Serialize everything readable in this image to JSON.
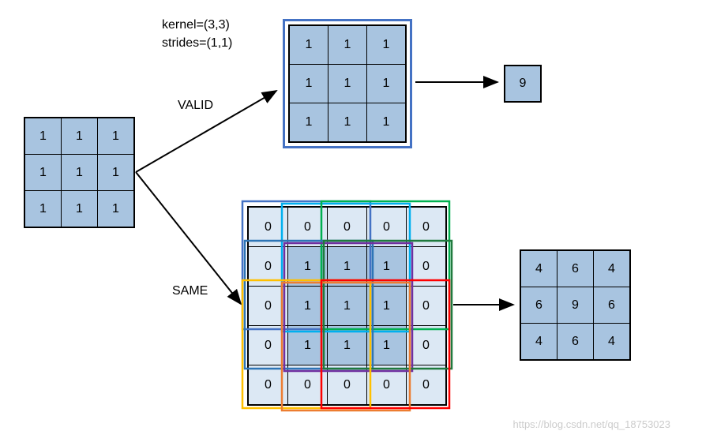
{
  "labels": {
    "kernel": "kernel=(3,3)",
    "strides": "strides=(1,1)",
    "valid": "VALID",
    "same": "SAME"
  },
  "input_grid": {
    "rows": 3,
    "cols": 3,
    "values": [
      [
        1,
        1,
        1
      ],
      [
        1,
        1,
        1
      ],
      [
        1,
        1,
        1
      ]
    ]
  },
  "valid_intermediate": {
    "rows": 3,
    "cols": 3,
    "values": [
      [
        1,
        1,
        1
      ],
      [
        1,
        1,
        1
      ],
      [
        1,
        1,
        1
      ]
    ]
  },
  "valid_output": {
    "rows": 1,
    "cols": 1,
    "values": [
      [
        9
      ]
    ]
  },
  "padded_grid": {
    "rows": 5,
    "cols": 5,
    "values": [
      [
        0,
        0,
        0,
        0,
        0
      ],
      [
        0,
        1,
        1,
        1,
        0
      ],
      [
        0,
        1,
        1,
        1,
        0
      ],
      [
        0,
        1,
        1,
        1,
        0
      ],
      [
        0,
        0,
        0,
        0,
        0
      ]
    ]
  },
  "same_output": {
    "rows": 3,
    "cols": 3,
    "values": [
      [
        4,
        6,
        4
      ],
      [
        6,
        9,
        6
      ],
      [
        4,
        6,
        4
      ]
    ]
  },
  "watermark": "https://blog.csdn.net/qq_18753023",
  "chart_data": {
    "type": "diagram",
    "title": "Convolution padding modes VALID vs SAME",
    "kernel_size": [
      3,
      3
    ],
    "strides": [
      1,
      1
    ],
    "input": [
      [
        1,
        1,
        1
      ],
      [
        1,
        1,
        1
      ],
      [
        1,
        1,
        1
      ]
    ],
    "valid": {
      "intermediate": [
        [
          1,
          1,
          1
        ],
        [
          1,
          1,
          1
        ],
        [
          1,
          1,
          1
        ]
      ],
      "output": [
        [
          9
        ]
      ]
    },
    "same": {
      "padded": [
        [
          0,
          0,
          0,
          0,
          0
        ],
        [
          0,
          1,
          1,
          1,
          0
        ],
        [
          0,
          1,
          1,
          1,
          0
        ],
        [
          0,
          1,
          1,
          1,
          0
        ],
        [
          0,
          0,
          0,
          0,
          0
        ]
      ],
      "output": [
        [
          4,
          6,
          4
        ],
        [
          6,
          9,
          6
        ],
        [
          4,
          6,
          4
        ]
      ]
    }
  }
}
